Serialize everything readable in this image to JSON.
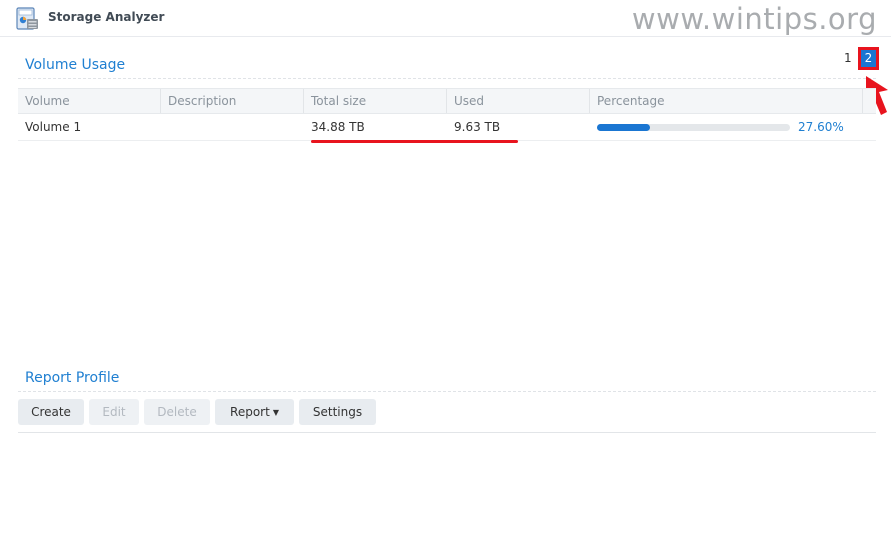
{
  "window": {
    "title": "Storage Analyzer",
    "watermark": "www.wintips.org"
  },
  "volume_usage": {
    "title": "Volume Usage",
    "pager": {
      "pages": [
        "1",
        "2"
      ],
      "current": "2"
    },
    "columns": [
      "Volume",
      "Description",
      "Total size",
      "Used",
      "Percentage"
    ],
    "rows": [
      {
        "volume": "Volume 1",
        "description": "",
        "total_size": "34.88 TB",
        "used": "9.63 TB",
        "percentage": 27.6,
        "percentage_label": "27.60%"
      }
    ]
  },
  "report_profile": {
    "title": "Report Profile",
    "buttons": {
      "create": "Create",
      "edit": "Edit",
      "delete": "Delete",
      "report": "Report",
      "settings": "Settings"
    }
  },
  "colors": {
    "accent": "#1a76d2",
    "highlight": "#e8141e"
  },
  "icons": [
    "storage-analyzer-app-icon",
    "dropdown-caret-icon",
    "pointer-arrow-icon"
  ]
}
